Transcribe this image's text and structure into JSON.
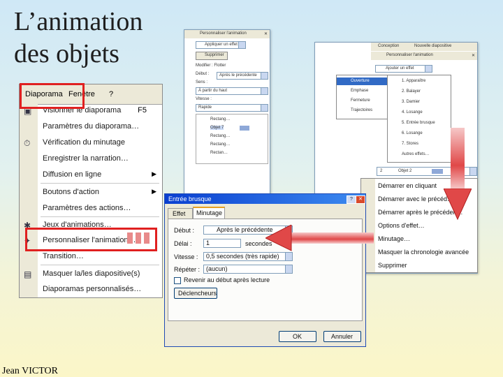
{
  "slide": {
    "title": "L’animation des objets",
    "author": "Jean VICTOR"
  },
  "colors": {
    "highlight": "#e02020",
    "arrow": "#e04848",
    "titlebar": "#0a3fd0"
  },
  "menubar": {
    "diaporama": "Diaporama",
    "fenetre": "Fenêtre",
    "help": "?"
  },
  "menu_items": [
    {
      "label": "Visionner le diaporama",
      "key": "F5",
      "icon": "slideshow-icon"
    },
    {
      "label": "Paramètres du diaporama…",
      "icon": ""
    },
    {
      "label": "Vérification du minutage",
      "icon": "stopwatch-icon"
    },
    {
      "label": "Enregistrer la narration…",
      "icon": ""
    },
    {
      "label": "Diffusion en ligne",
      "submenu": true,
      "icon": ""
    },
    {
      "label": "Boutons d'action",
      "submenu": true,
      "icon": ""
    },
    {
      "label": "Paramètres des actions…",
      "icon": ""
    },
    {
      "label": "Jeux d'animations…",
      "icon": "animation-icon"
    },
    {
      "label": "Personnaliser l'animation…",
      "icon": "custom-animation-icon"
    },
    {
      "label": "Transition…",
      "icon": ""
    },
    {
      "label": "Masquer la/les diapositive(s)",
      "icon": "hide-slide-icon"
    },
    {
      "label": "Diaporamas personnalisés…",
      "icon": ""
    }
  ],
  "pane_left": {
    "header": "Personnaliser l'animation",
    "apply_btn": "Appliquer un effet",
    "remove_btn": "Supprimer",
    "modify_label": "Modifier : Flotter",
    "debut_label": "Début :",
    "debut_value": "Après le précédente",
    "sens_label": "Sens :",
    "sens_value": "À partir du haut",
    "vitesse_label": "Vitesse :",
    "vitesse_value": "Rapide",
    "list": [
      "Rectang…",
      "Objet 7",
      "Rectang…",
      "Rectang…",
      "Rectan…"
    ]
  },
  "pane_right": {
    "toolbar_conception": "Conception",
    "toolbar_new": "Nouvelle diapositive",
    "header": "Personnaliser l'animation",
    "apply_btn": "Ajouter un effet",
    "categories": [
      "Ouverture",
      "Emphase",
      "Fermeture",
      "Trajectoires"
    ],
    "effects": [
      "1. Apparaître",
      "2. Balayer",
      "3. Damier",
      "4. Losange",
      "5. Entrée brusque",
      "6. Losange",
      "7. Stores",
      "Autres effets…"
    ],
    "object_item": "Objet 2",
    "context": [
      "Démarrer en cliquant",
      "Démarrer avec le précéd…",
      "Démarrer après le précéden…",
      "Options d'effet…",
      "Minutage…",
      "Masquer la chronologie avancée",
      "Supprimer"
    ]
  },
  "dialog": {
    "title": "Entrée brusque",
    "tabs": [
      "Effet",
      "Minutage"
    ],
    "debut_label": "Début :",
    "debut_value": "Après le précédente",
    "delai_label": "Délai :",
    "delai_value": "1",
    "delai_unit": "secondes",
    "vitesse_label": "Vitesse :",
    "vitesse_value": "0,5 secondes (très rapide)",
    "repeter_label": "Répéter :",
    "repeter_value": "(aucun)",
    "rewind_label": "Revenir au début après lecture",
    "triggers_btn": "Déclencheurs",
    "ok_btn": "OK",
    "cancel_btn": "Annuler"
  }
}
